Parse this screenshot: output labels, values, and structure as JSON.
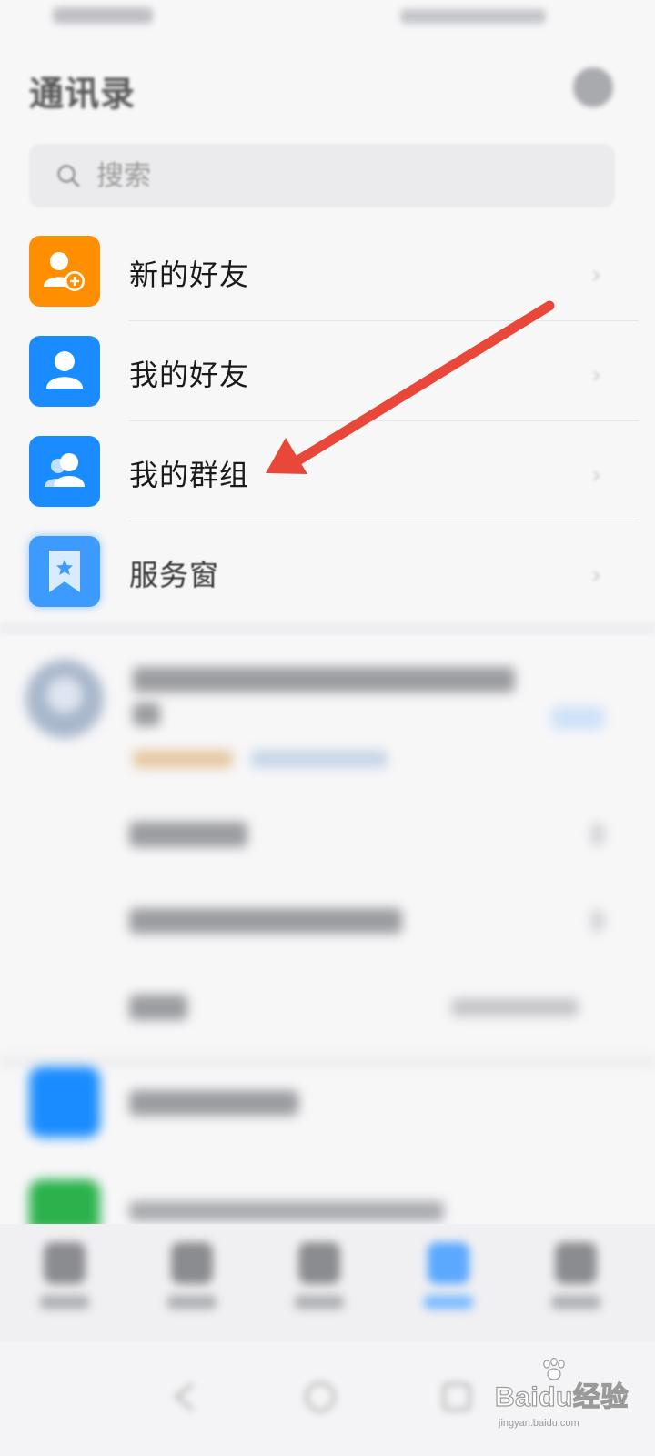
{
  "header": {
    "title": "通讯录"
  },
  "search": {
    "placeholder": "搜索"
  },
  "menu": [
    {
      "label": "新的好友",
      "icon": "person-add-icon",
      "color": "#FF8F00"
    },
    {
      "label": "我的好友",
      "icon": "person-icon",
      "color": "#1A8CFF"
    },
    {
      "label": "我的群组",
      "icon": "group-icon",
      "color": "#1A8CFF"
    },
    {
      "label": "服务窗",
      "icon": "bookmark-star-icon",
      "color": "#3D9BFF"
    }
  ],
  "annotation": {
    "arrow_color": "#E8473A",
    "points_to": "我的群组"
  },
  "watermark": {
    "brand": "Baidu经验",
    "url": "jingyan.baidu.com"
  },
  "colors": {
    "background": "#F7F7F8",
    "search_bg": "#EBEBED",
    "accent_blue": "#1A8CFF",
    "accent_orange": "#FF8F00"
  }
}
